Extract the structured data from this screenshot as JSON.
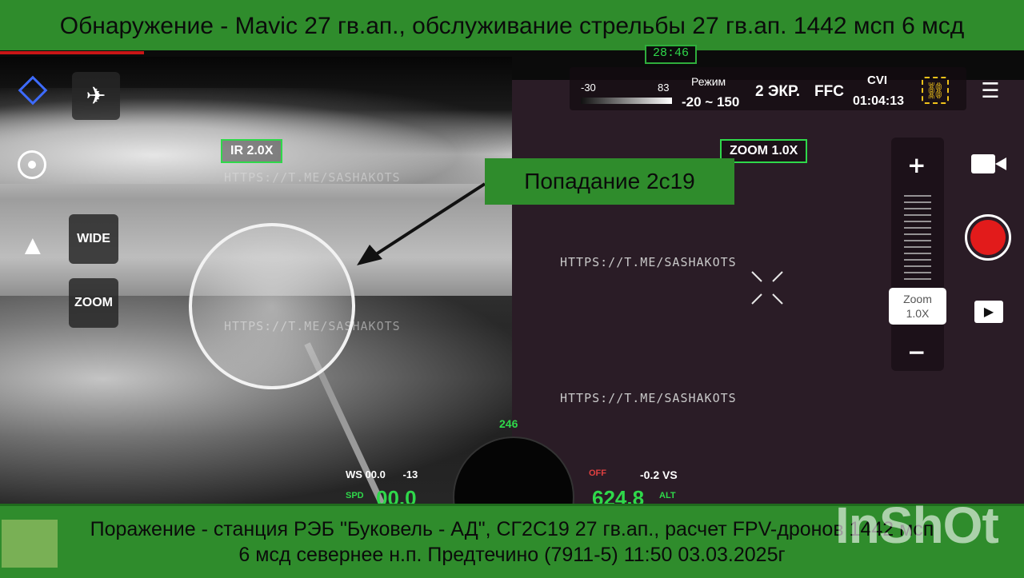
{
  "banners": {
    "top": "Обнаружение - Mavic 27 гв.ап., обслуживание стрельбы 27 гв.ап. 1442 мсп 6 мсд",
    "bottom_line1": "Поражение - станция РЭБ \"Буковель - АД\", СГ2С19 27 гв.ап., расчет FPV-дронов 1442 мсп",
    "bottom_line2": "6 мсд севернее н.п. Предтечино (7911-5) 11:50 03.03.2025г"
  },
  "status": {
    "timer": "28:46"
  },
  "annotation": {
    "hit_label": "Попадание 2с19"
  },
  "views": {
    "ir_tag": "IR 2.0X",
    "zoom_tag": "ZOOM 1.0X"
  },
  "watermarks": [
    "HTTPS://T.ME/SASHAKOTS",
    "HTTPS://T.ME/SASHAKOTS",
    "HTTPS://T.ME/SASHAKOTS",
    "HTTPS://T.ME/SASHAKOTS"
  ],
  "left_controls": {
    "wide_label": "WIDE",
    "zoom_label": "ZOOM"
  },
  "hud": {
    "scale_min": "-30",
    "scale_max": "83",
    "mode_label": "Режим",
    "range": "-20 ~ 150",
    "screen": "2 ЭКР.",
    "ffc": "FFC",
    "cvi": "CVI",
    "time": "01:04:13"
  },
  "zoom_panel": {
    "plus": "+",
    "minus": "−",
    "pill_label": "Zoom",
    "pill_value": "1.0X"
  },
  "telemetry": {
    "ws": "WS 00.0",
    "ws_dir": "-13",
    "vs": "-0.2 VS",
    "spd_label": "SPD",
    "spd": "00.0",
    "alt": "624.8",
    "alt_label": "ALT",
    "heading": "246",
    "off": "OFF"
  },
  "brand": {
    "app_watermark": "InShOt"
  },
  "icons": [
    "diamond-icon",
    "drone-icon",
    "gps-icon",
    "compass-icon",
    "link-icon",
    "settings-icon",
    "camera-icon",
    "record-icon",
    "playback-icon"
  ],
  "colors": {
    "banner": "#2f8c2c",
    "hud_green": "#2fd84a",
    "record_red": "#e21b1b",
    "screen_yellow": "#f0c21a"
  }
}
